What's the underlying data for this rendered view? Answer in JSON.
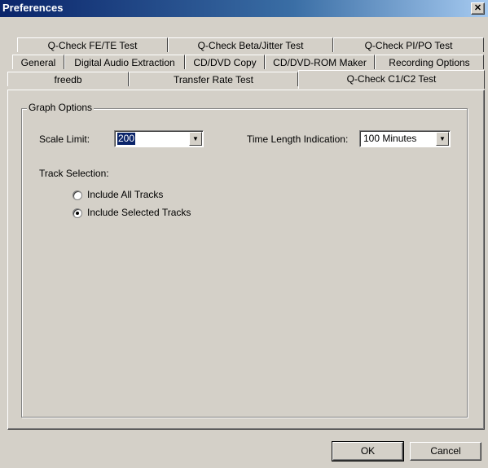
{
  "window": {
    "title": "Preferences",
    "close_glyph": "✕"
  },
  "tabs": {
    "row1": [
      "Q-Check FE/TE Test",
      "Q-Check Beta/Jitter Test",
      "Q-Check PI/PO Test"
    ],
    "row2": [
      "General",
      "Digital Audio Extraction",
      "CD/DVD Copy",
      "CD/DVD-ROM Maker",
      "Recording Options"
    ],
    "row3": [
      "freedb",
      "Transfer Rate Test",
      "Q-Check C1/C2 Test"
    ],
    "active": "Q-Check C1/C2 Test"
  },
  "graph_options": {
    "legend": "Graph Options",
    "scale_limit_label": "Scale Limit:",
    "scale_limit_value": "200",
    "time_length_label": "Time Length Indication:",
    "time_length_value": "100 Minutes",
    "dropdown_glyph": "▼"
  },
  "track_selection": {
    "label": "Track Selection:",
    "options": [
      "Include All Tracks",
      "Include Selected Tracks"
    ],
    "selected": "Include Selected Tracks"
  },
  "buttons": {
    "ok": "OK",
    "cancel": "Cancel"
  }
}
